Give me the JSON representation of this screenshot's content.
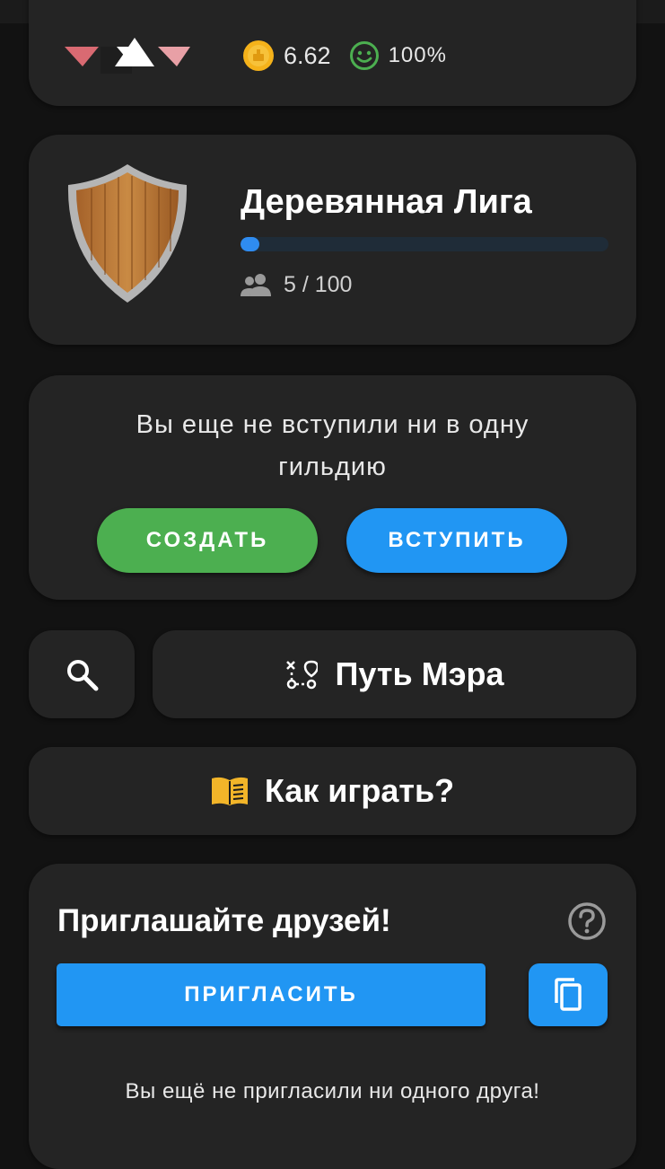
{
  "header": {
    "coins": "6.62",
    "mood": "100%"
  },
  "league": {
    "title": "Деревянная Лига",
    "progress_fraction": 0.05,
    "members": "5 / 100"
  },
  "guild": {
    "message": "Вы еще не вступили ни в одну гильдию",
    "create_label": "СОЗДАТЬ",
    "join_label": "ВСТУПИТЬ"
  },
  "actions": {
    "path_label": "Путь Мэра",
    "howto_label": "Как играть?"
  },
  "invite": {
    "title": "Приглашайте друзей!",
    "invite_label": "ПРИГЛАСИТЬ",
    "note": "Вы ещё не пригласили ни одного друга!"
  },
  "colors": {
    "background": "#121212",
    "card": "#242424",
    "accent_blue": "#2196f3",
    "accent_green": "#4caf50",
    "coin": "#f5b21a",
    "smile": "#4caf50"
  },
  "icons": {
    "coin": "coin-icon",
    "mood": "smile-icon",
    "shield": "wooden-shield-icon",
    "members": "people-icon",
    "search": "search-icon",
    "path": "route-icon",
    "howto": "book-icon",
    "help": "help-circle-icon",
    "copy": "copy-icon"
  }
}
